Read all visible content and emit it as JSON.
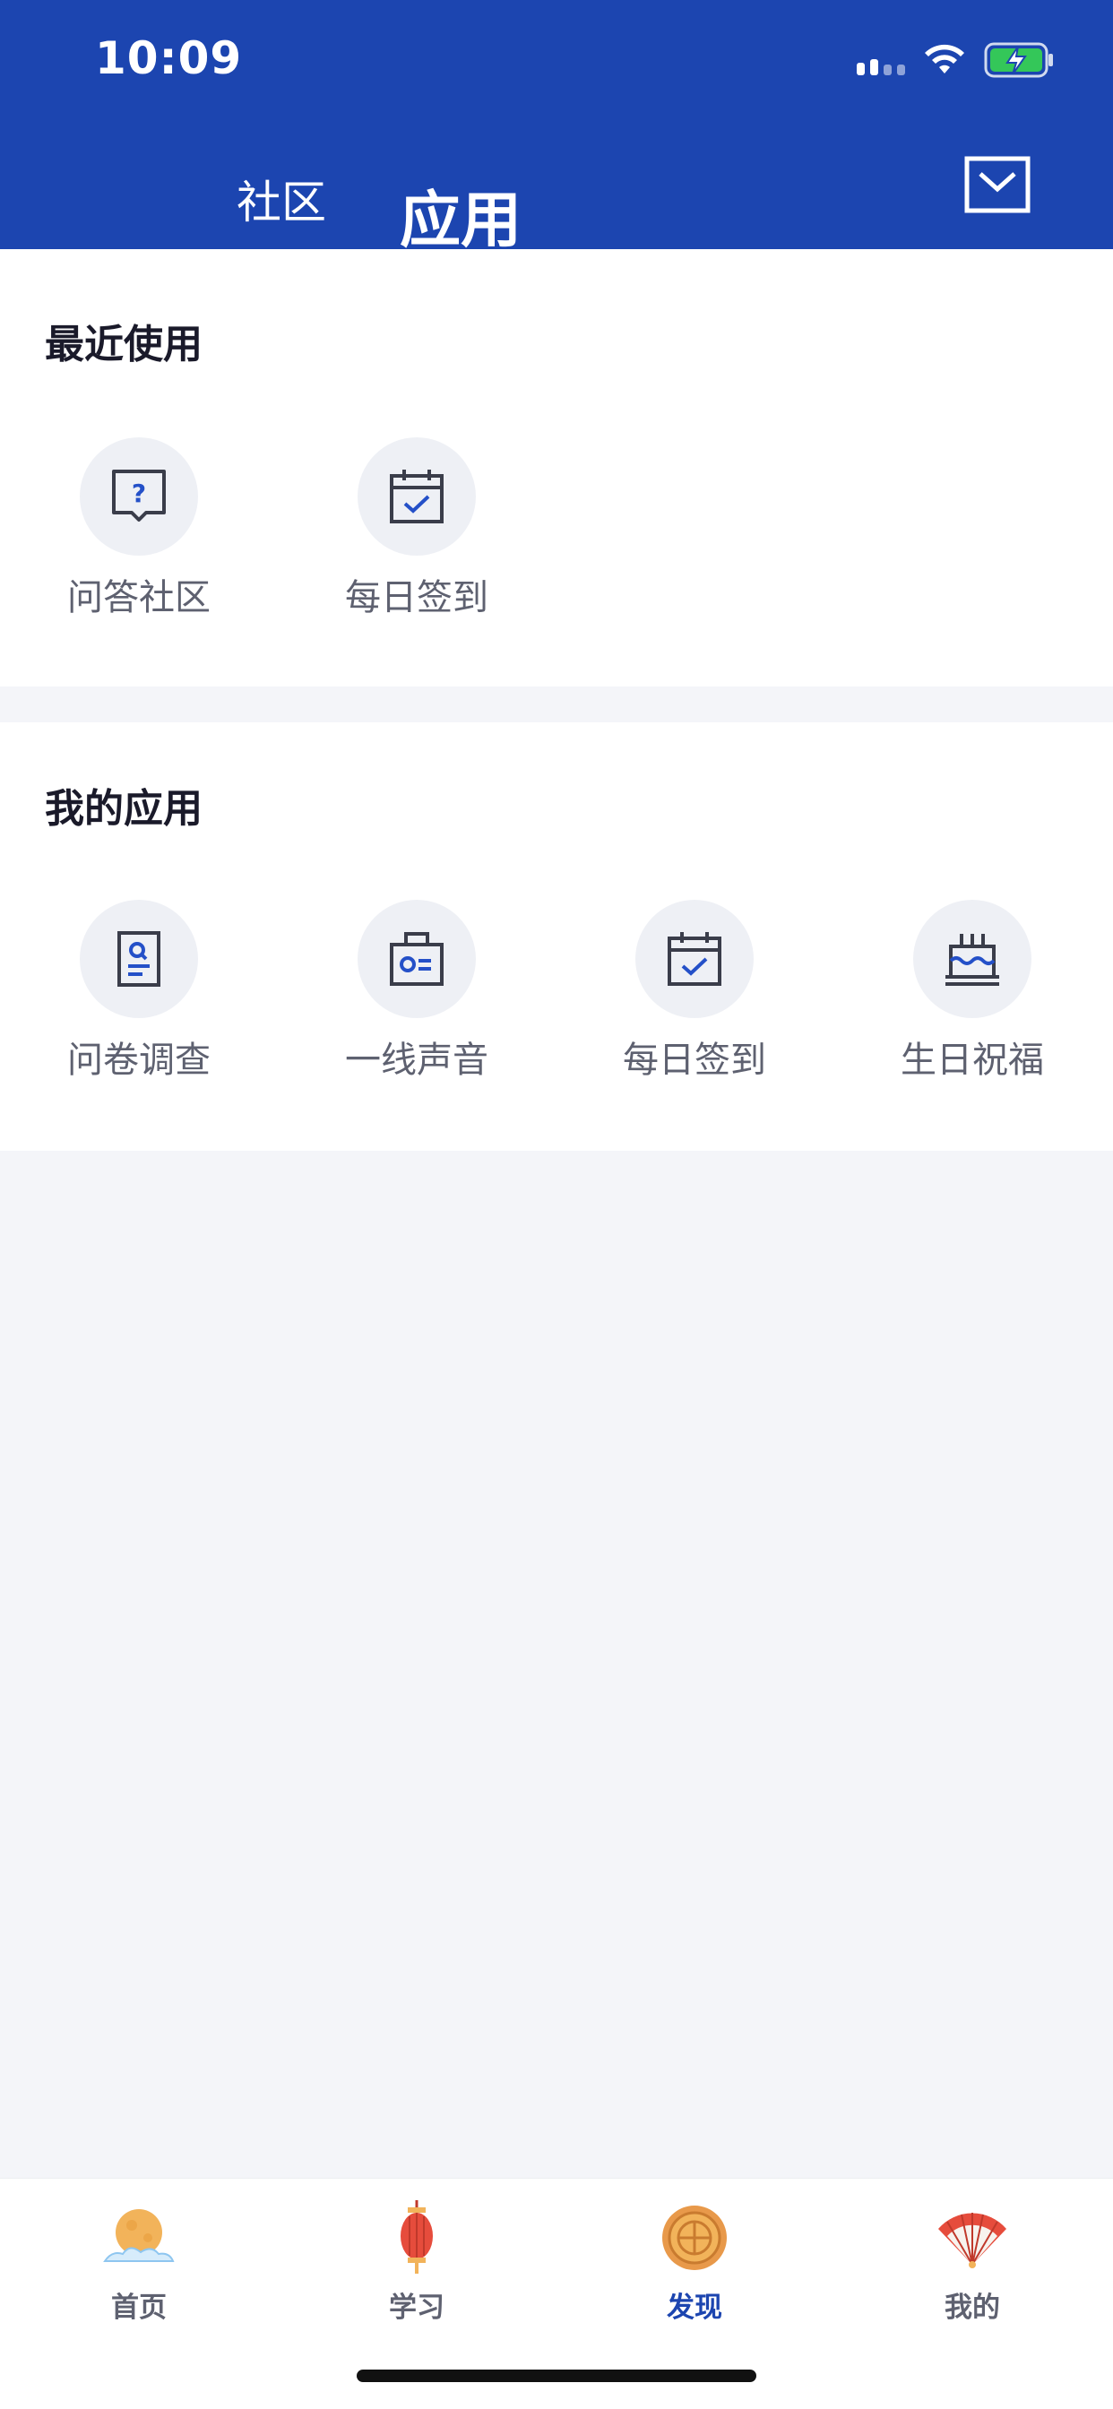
{
  "status_bar": {
    "time": "10:09"
  },
  "header": {
    "tabs": [
      {
        "label": "社区",
        "active": false
      },
      {
        "label": "应用",
        "active": true
      }
    ],
    "mail_icon": "mail-icon",
    "background_color": "#1c45b0"
  },
  "recent": {
    "title": "最近使用",
    "apps": [
      {
        "label": "问答社区",
        "icon": "qa-bubble-icon"
      },
      {
        "label": "每日签到",
        "icon": "calendar-check-icon"
      }
    ]
  },
  "mine": {
    "title": "我的应用",
    "apps": [
      {
        "label": "问卷调查",
        "icon": "survey-doc-icon"
      },
      {
        "label": "一线声音",
        "icon": "id-card-icon"
      },
      {
        "label": "每日签到",
        "icon": "calendar-check-icon"
      },
      {
        "label": "生日祝福",
        "icon": "birthday-cake-icon"
      }
    ]
  },
  "bottom_nav": {
    "items": [
      {
        "label": "首页",
        "icon": "moon-cloud-icon",
        "active": false
      },
      {
        "label": "学习",
        "icon": "lantern-icon",
        "active": false
      },
      {
        "label": "发现",
        "icon": "mooncake-icon",
        "active": true
      },
      {
        "label": "我的",
        "icon": "folding-fan-icon",
        "active": false
      }
    ]
  },
  "colors": {
    "accent": "#1c45b0",
    "icon_stroke": "#3a3d4a",
    "icon_accent": "#2450c8"
  }
}
